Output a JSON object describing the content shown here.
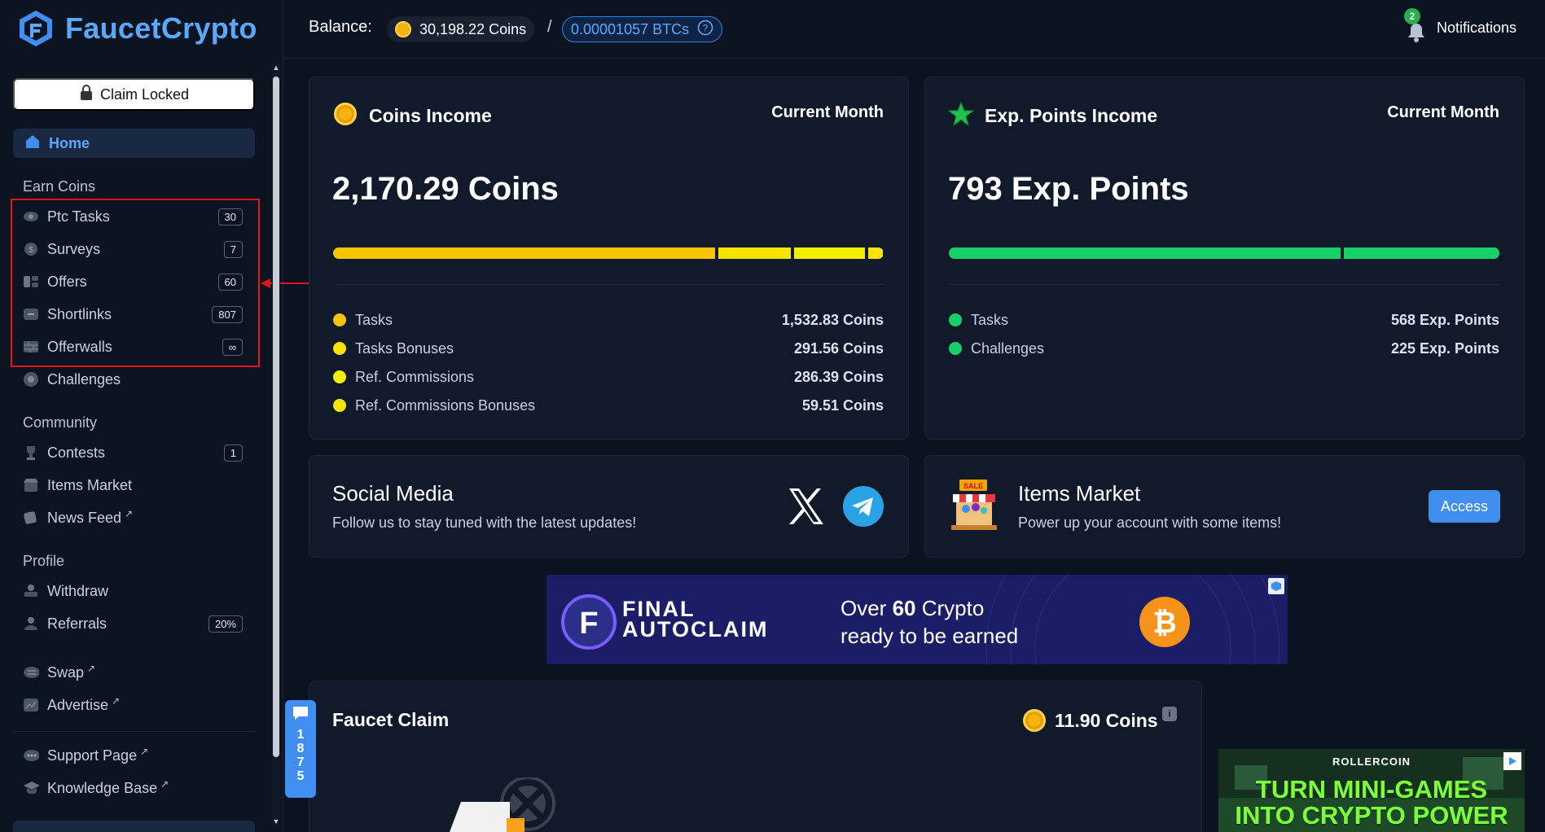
{
  "brand": {
    "name": "FaucetCrypto",
    "color": "#5aa9ff"
  },
  "sidebar": {
    "claim_label": "Claim Locked",
    "home_label": "Home",
    "sections": {
      "earn": "Earn Coins",
      "community": "Community",
      "profile": "Profile"
    },
    "earn_items": [
      {
        "label": "Ptc Tasks",
        "badge": "30",
        "icon": "eye-icon"
      },
      {
        "label": "Surveys",
        "badge": "7",
        "icon": "coin-icon"
      },
      {
        "label": "Offers",
        "badge": "60",
        "icon": "offers-icon"
      },
      {
        "label": "Shortlinks",
        "badge": "807",
        "icon": "link-icon"
      },
      {
        "label": "Offerwalls",
        "badge": "∞",
        "icon": "wall-icon"
      },
      {
        "label": "Challenges",
        "icon": "target-icon"
      }
    ],
    "community_items": [
      {
        "label": "Contests",
        "badge": "1",
        "icon": "trophy-icon"
      },
      {
        "label": "Items Market",
        "icon": "market-icon"
      },
      {
        "label": "News Feed",
        "icon": "news-icon",
        "ext": "↗"
      }
    ],
    "profile_items": [
      {
        "label": "Withdraw",
        "icon": "withdraw-icon"
      },
      {
        "label": "Referrals",
        "badge": "20%",
        "icon": "users-icon"
      },
      {
        "label": "Swap",
        "icon": "swap-icon",
        "ext": "↗"
      },
      {
        "label": "Advertise",
        "icon": "advertise-icon",
        "ext": "↗"
      },
      {
        "label": "Support Page",
        "icon": "support-icon",
        "ext": "↗"
      },
      {
        "label": "Knowledge Base",
        "icon": "book-icon",
        "ext": "↗"
      }
    ]
  },
  "topbar": {
    "balance_label": "Balance:",
    "coins": "30,198.22 Coins",
    "separator": "/",
    "btc": "0.00001057 BTCs",
    "notif_count": "2",
    "notif_label": "Notifications"
  },
  "coins_income": {
    "title": "Coins Income",
    "period": "Current Month",
    "total": "2,170.29 Coins",
    "rows": [
      {
        "label": "Tasks",
        "value": "1,532.83 Coins",
        "color": "#f8c300",
        "share": 0.706
      },
      {
        "label": "Tasks Bonuses",
        "value": "291.56 Coins",
        "color": "#f5e400",
        "share": 0.134
      },
      {
        "label": "Ref. Commissions",
        "value": "286.39 Coins",
        "color": "#f0f000",
        "share": 0.132
      },
      {
        "label": "Ref. Commissions Bonuses",
        "value": "59.51 Coins",
        "color": "#f5e400",
        "share": 0.027
      }
    ]
  },
  "exp_income": {
    "title": "Exp. Points Income",
    "period": "Current Month",
    "total": "793 Exp. Points",
    "rows": [
      {
        "label": "Tasks",
        "value": "568 Exp. Points",
        "color": "#16d16a",
        "share": 0.716
      },
      {
        "label": "Challenges",
        "value": "225 Exp. Points",
        "color": "#16d16a",
        "share": 0.284
      }
    ]
  },
  "social": {
    "title": "Social Media",
    "subtitle": "Follow us to stay tuned with the latest updates!"
  },
  "market": {
    "title": "Items Market",
    "subtitle": "Power up your account with some items!",
    "button": "Access",
    "sale_tag": "SALE"
  },
  "ad_banner": {
    "brand_line1": "FINAL",
    "brand_line2": "AUTOCLAIM",
    "headline_pre": "Over",
    "headline_num": "60",
    "headline_post": "Crypto",
    "line2": "ready to be earned"
  },
  "faucet": {
    "title": "Faucet Claim",
    "amount": "11.90 Coins",
    "info": "i"
  },
  "chat": {
    "digits": [
      "1",
      "8",
      "7",
      "5"
    ]
  },
  "ad2": {
    "brand": "ROLLERCOIN",
    "line1": "TURN MINI-GAMES",
    "line2": "INTO CRYPTO POWER"
  }
}
